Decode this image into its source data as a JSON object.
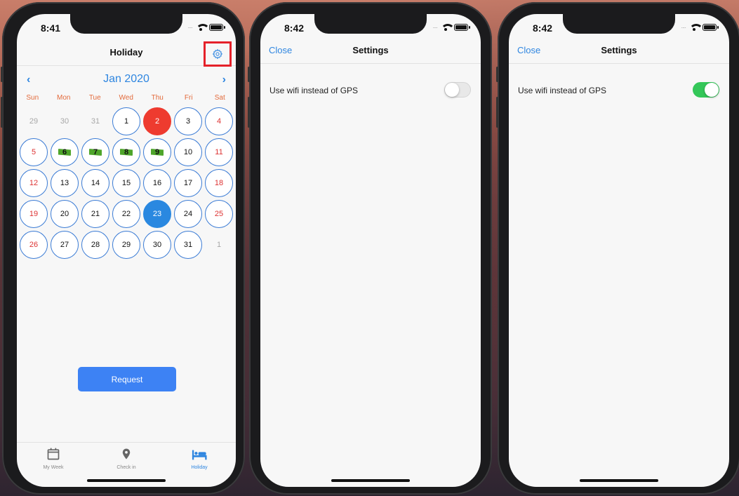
{
  "screens": [
    {
      "status_time": "8:41",
      "nav_title": "Holiday",
      "month_label": "Jan 2020",
      "prev_icon": "‹",
      "next_icon": "›",
      "weekdays": [
        "Sun",
        "Mon",
        "Tue",
        "Wed",
        "Thu",
        "Fri",
        "Sat"
      ],
      "weeks": [
        [
          "29",
          "30",
          "31",
          "1",
          "2",
          "3",
          "4"
        ],
        [
          "5",
          "6",
          "7",
          "8",
          "9",
          "10",
          "11"
        ],
        [
          "12",
          "13",
          "14",
          "15",
          "16",
          "17",
          "18"
        ],
        [
          "19",
          "20",
          "21",
          "22",
          "23",
          "24",
          "25"
        ],
        [
          "26",
          "27",
          "28",
          "29",
          "30",
          "31",
          "1"
        ]
      ],
      "request_label": "Request",
      "tabs": [
        {
          "label": "My Week",
          "icon": "calendar-icon"
        },
        {
          "label": "Check in",
          "icon": "location-pin-icon"
        },
        {
          "label": "Holiday",
          "icon": "bed-icon"
        }
      ]
    },
    {
      "status_time": "8:42",
      "close_label": "Close",
      "nav_title": "Settings",
      "setting_label": "Use wifi instead of GPS",
      "toggle_on": false
    },
    {
      "status_time": "8:42",
      "close_label": "Close",
      "nav_title": "Settings",
      "setting_label": "Use wifi instead of GPS",
      "toggle_on": true
    }
  ],
  "colors": {
    "accent": "#2f86e0",
    "today": "#ee3b2f",
    "selected": "#2a88e0",
    "toggle_on": "#34c759",
    "flag": "#4ea52a",
    "highlight_box": "#e5212a"
  }
}
